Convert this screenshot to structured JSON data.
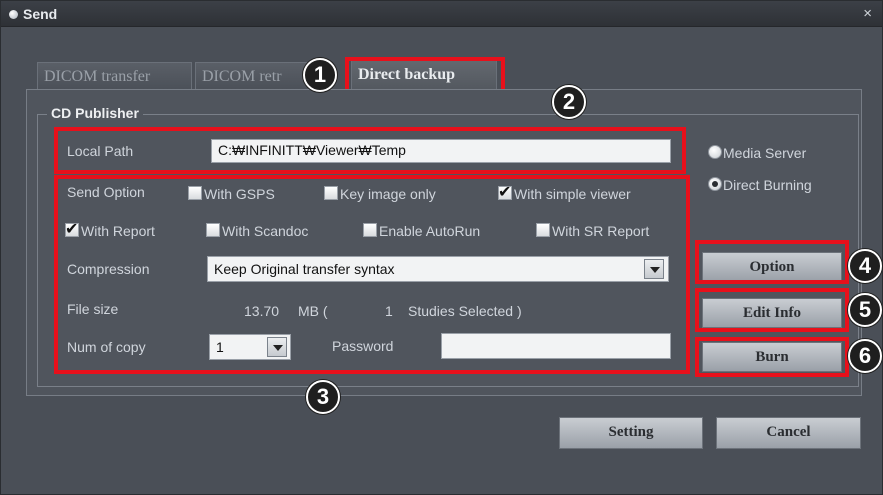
{
  "window": {
    "title": "Send",
    "close_glyph": "×"
  },
  "tabs": [
    {
      "label": "DICOM transfer",
      "active": false
    },
    {
      "label": "DICOM retr",
      "active": false
    },
    {
      "label": "Direct backup",
      "active": true
    }
  ],
  "group": {
    "title": "CD Publisher"
  },
  "local_path": {
    "label": "Local Path",
    "value": "C:₩INFINITT₩Viewer₩Temp"
  },
  "send_option": {
    "label": "Send Option",
    "options": [
      {
        "label": "With GSPS",
        "checked": false
      },
      {
        "label": "Key image only",
        "checked": false
      },
      {
        "label": "With simple viewer",
        "checked": true
      },
      {
        "label": "With Report",
        "checked": true
      },
      {
        "label": "With Scandoc",
        "checked": false
      },
      {
        "label": "Enable AutoRun",
        "checked": false
      },
      {
        "label": "With SR Report",
        "checked": false
      }
    ]
  },
  "compression": {
    "label": "Compression",
    "value": "Keep Original transfer syntax"
  },
  "file_size": {
    "label": "File size",
    "size": "13.70",
    "unit": "MB (",
    "count": "1",
    "suffix": "Studies Selected )"
  },
  "num_of_copy": {
    "label": "Num of copy",
    "value": "1"
  },
  "password": {
    "label": "Password",
    "value": ""
  },
  "radios": [
    {
      "label": "Media Server",
      "selected": false
    },
    {
      "label": "Direct Burning",
      "selected": true
    }
  ],
  "buttons": {
    "option": "Option",
    "edit_info": "Edit Info",
    "burn": "Burn",
    "setting": "Setting",
    "cancel": "Cancel"
  },
  "callouts": [
    "1",
    "2",
    "3",
    "4",
    "5",
    "6"
  ],
  "colors": {
    "highlight": "#e8101b",
    "window_bg": "#4a4f57"
  },
  "icons": {
    "check": "✔",
    "dropdown": "chevron-down-icon"
  }
}
